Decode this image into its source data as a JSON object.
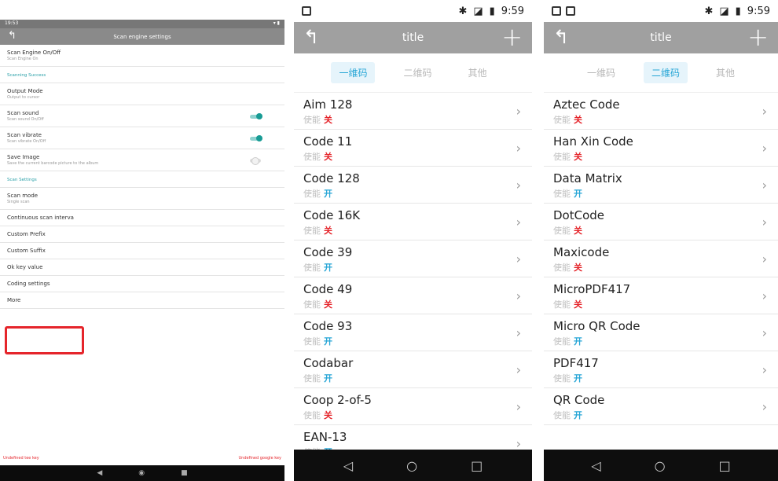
{
  "phone1": {
    "status_time": "19:53",
    "title": "Scan engine settings",
    "items": [
      {
        "type": "item",
        "title": "Scan Engine On/Off",
        "sub": "Scan Engine On"
      },
      {
        "type": "section",
        "title": "Scanning Success"
      },
      {
        "type": "item",
        "title": "Output Mode",
        "sub": "Output to cursor"
      },
      {
        "type": "toggle",
        "title": "Scan sound",
        "sub": "Scan sound On/Off",
        "state": "on"
      },
      {
        "type": "toggle",
        "title": "Scan vibrate",
        "sub": "Scan vibrate On/Off",
        "state": "on"
      },
      {
        "type": "toggle",
        "title": "Save Image",
        "sub": "Save the current barcode picture to the album",
        "state": "off"
      },
      {
        "type": "section",
        "title": "Scan Settings"
      },
      {
        "type": "item",
        "title": "Scan mode",
        "sub": "Single scan"
      },
      {
        "type": "item",
        "title": "Continuous scan interva",
        "sub": ""
      },
      {
        "type": "item",
        "title": "Custom Prefix",
        "sub": ""
      },
      {
        "type": "item",
        "title": "Custom Suffix",
        "sub": ""
      },
      {
        "type": "item",
        "title": "Ok key value",
        "sub": ""
      },
      {
        "type": "item",
        "title": "Coding settings",
        "sub": ""
      },
      {
        "type": "item",
        "title": "More",
        "sub": ""
      }
    ],
    "footer_left": "Undefined tee key",
    "footer_right": "Undefined google key"
  },
  "phone2": {
    "status_time": "9:59",
    "title": "title",
    "tabs": [
      {
        "label": "一维码",
        "active": true
      },
      {
        "label": "二维码",
        "active": false
      },
      {
        "label": "其他",
        "active": false
      }
    ],
    "status_label": "使能",
    "on_text": "开",
    "off_text": "关",
    "codes": [
      {
        "name": "Aim 128",
        "enabled": false
      },
      {
        "name": "Code 11",
        "enabled": false
      },
      {
        "name": "Code 128",
        "enabled": true
      },
      {
        "name": "Code 16K",
        "enabled": false
      },
      {
        "name": "Code 39",
        "enabled": true
      },
      {
        "name": "Code 49",
        "enabled": false
      },
      {
        "name": "Code 93",
        "enabled": true
      },
      {
        "name": "Codabar",
        "enabled": true
      },
      {
        "name": "Coop 2-of-5",
        "enabled": false
      },
      {
        "name": "EAN-13",
        "enabled": true
      }
    ]
  },
  "phone3": {
    "status_time": "9:59",
    "title": "title",
    "tabs": [
      {
        "label": "一维码",
        "active": false
      },
      {
        "label": "二维码",
        "active": true
      },
      {
        "label": "其他",
        "active": false
      }
    ],
    "status_label": "使能",
    "on_text": "开",
    "off_text": "关",
    "codes": [
      {
        "name": "Aztec Code",
        "enabled": false
      },
      {
        "name": "Han Xin Code",
        "enabled": false
      },
      {
        "name": "Data Matrix",
        "enabled": true
      },
      {
        "name": "DotCode",
        "enabled": false
      },
      {
        "name": "Maxicode",
        "enabled": false
      },
      {
        "name": "MicroPDF417",
        "enabled": false
      },
      {
        "name": "Micro QR Code",
        "enabled": true
      },
      {
        "name": "PDF417",
        "enabled": true
      },
      {
        "name": "QR Code",
        "enabled": true
      }
    ]
  },
  "colors": {
    "accent": "#27a6d6",
    "off_red": "#e5252b",
    "toggle_teal": "#179b94",
    "highlight_red": "#e5252b"
  },
  "icons": {
    "back": "back-arrow-icon",
    "add": "plus-icon",
    "chevron": "chevron-right-icon",
    "bluetooth": "bluetooth-icon",
    "battery": "battery-icon"
  }
}
